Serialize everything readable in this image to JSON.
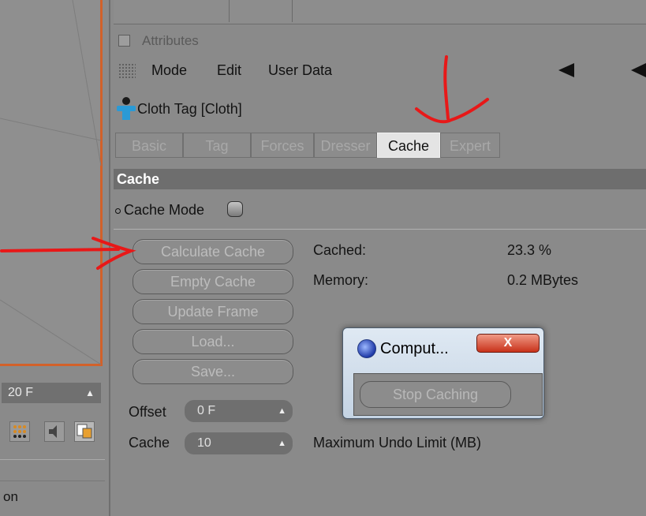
{
  "left_panel": {
    "frame_value": "20 F",
    "row_label": "on"
  },
  "attributes": {
    "header_title": "Attributes",
    "menu": [
      "Mode",
      "Edit",
      "User Data"
    ],
    "tag_title": "Cloth Tag [Cloth]",
    "tabs": [
      {
        "label": "Basic",
        "active": false
      },
      {
        "label": "Tag",
        "active": false
      },
      {
        "label": "Forces",
        "active": false
      },
      {
        "label": "Dresser",
        "active": false
      },
      {
        "label": "Cache",
        "active": true
      },
      {
        "label": "Expert",
        "active": false
      }
    ],
    "section_title": "Cache",
    "cache_mode_label": "Cache Mode"
  },
  "cache_buttons": [
    "Calculate Cache",
    "Empty Cache",
    "Update Frame",
    "Load...",
    "Save..."
  ],
  "stats": {
    "cached_label": "Cached:",
    "cached_value": "23.3 %",
    "memory_label": "Memory:",
    "memory_value": "0.2 MBytes"
  },
  "fields": {
    "offset_label": "Offset",
    "offset_value": "0 F",
    "cache_label": "Cache",
    "cache_value": "10",
    "undo_label": "Maximum Undo Limit (MB)"
  },
  "dialog": {
    "title": "Comput...",
    "close_label": "X",
    "button": "Stop Caching"
  },
  "colors": {
    "annotation": "#e81818",
    "viewport_border": "#d2612a",
    "active_tab": "#e4e4e4"
  }
}
